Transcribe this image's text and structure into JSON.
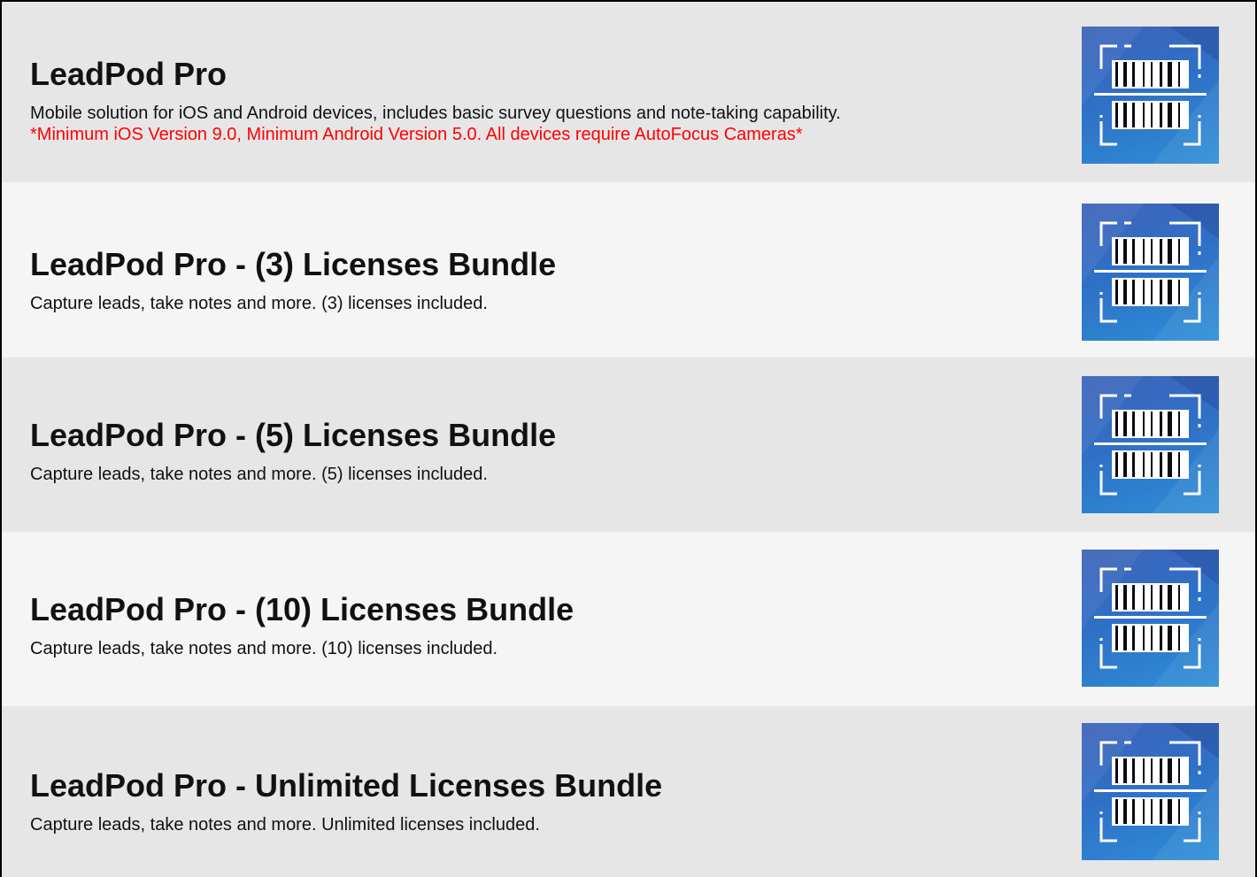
{
  "products": [
    {
      "title": "LeadPod Pro",
      "description": "Mobile solution for iOS and Android devices, includes basic survey questions and note-taking capability.",
      "note": "*Minimum iOS Version 9.0, Minimum Android Version 5.0. All devices require AutoFocus Cameras*",
      "icon": "barcode-scanner-icon"
    },
    {
      "title": "LeadPod Pro - (3) Licenses Bundle",
      "description": "Capture leads, take notes and more. (3) licenses included.",
      "icon": "barcode-scanner-icon"
    },
    {
      "title": "LeadPod Pro - (5) Licenses Bundle",
      "description": "Capture leads, take notes and more. (5) licenses included.",
      "icon": "barcode-scanner-icon"
    },
    {
      "title": "LeadPod Pro - (10) Licenses Bundle",
      "description": "Capture leads, take notes and more. (10) licenses included.",
      "icon": "barcode-scanner-icon"
    },
    {
      "title": "LeadPod Pro - Unlimited Licenses Bundle",
      "description": "Capture leads, take notes and more. Unlimited licenses included.",
      "icon": "barcode-scanner-icon"
    }
  ],
  "colors": {
    "row_dark": "#e6e6e6",
    "row_light": "#f5f5f5",
    "note_red": "#ff0000",
    "icon_blue": "#2f70c7"
  }
}
